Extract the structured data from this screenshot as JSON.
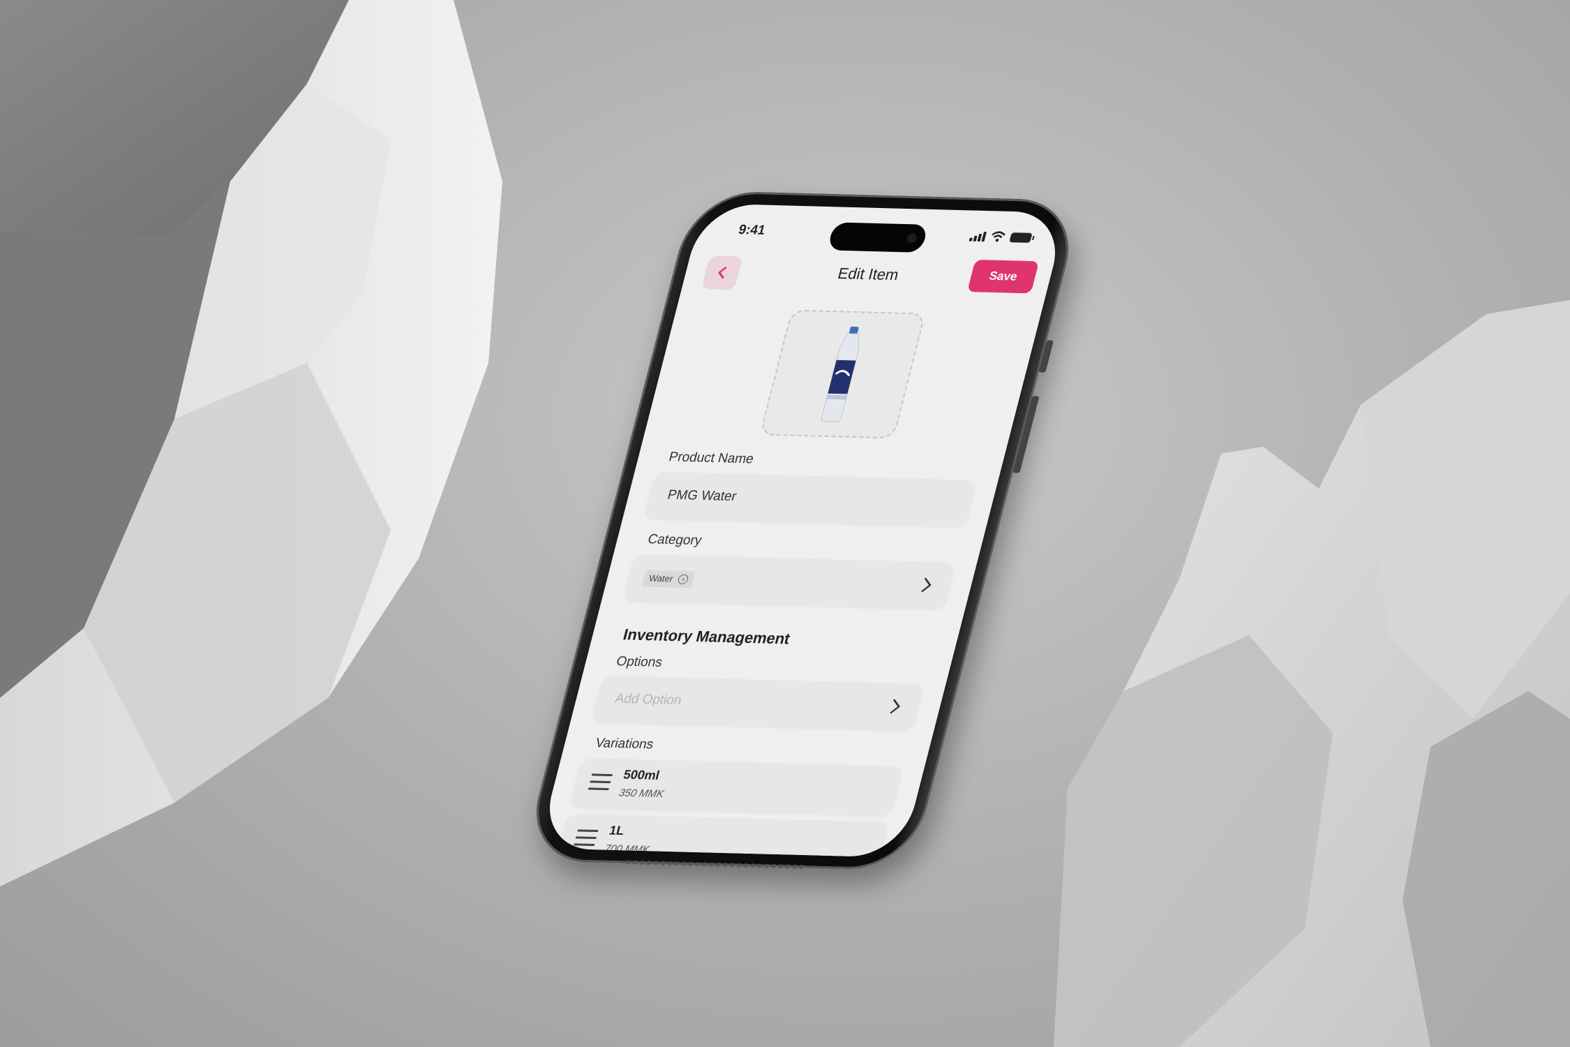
{
  "status_bar": {
    "time": "9:41"
  },
  "header": {
    "title": "Edit Item",
    "save_label": "Save"
  },
  "form": {
    "product_name": {
      "label": "Product Name",
      "value": "PMG Water"
    },
    "category": {
      "label": "Category",
      "chip": "Water"
    },
    "inventory_title": "Inventory Management",
    "options": {
      "label": "Options",
      "placeholder": "Add Option"
    },
    "variations": {
      "label": "Variations",
      "items": [
        {
          "name": "500ml",
          "price": "350 MMK"
        },
        {
          "name": "1L",
          "price": "700 MMK"
        }
      ]
    }
  },
  "colors": {
    "accent": "#e0346e",
    "accent_soft": "#ecd4dc"
  },
  "icons": [
    "chevron-left-icon",
    "chevron-right-icon",
    "close-circle-icon",
    "drag-handle-icon",
    "signal-icon",
    "wifi-icon",
    "battery-icon"
  ]
}
